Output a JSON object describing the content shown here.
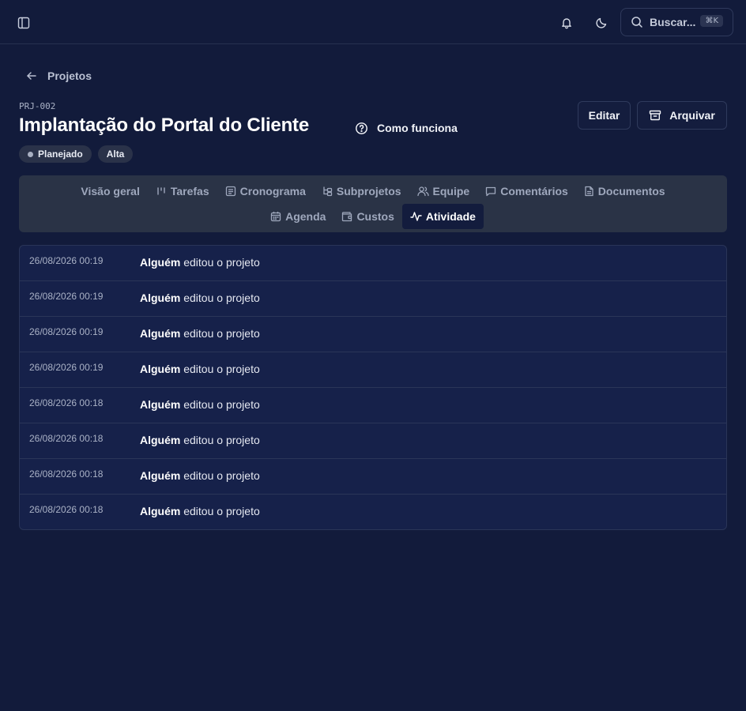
{
  "topbar": {
    "search_placeholder": "Buscar...",
    "search_shortcut": "⌘K",
    "icons": [
      "sidebar-toggle-icon",
      "bell-icon",
      "moon-icon",
      "search-icon"
    ]
  },
  "header": {
    "back_label": "Projetos",
    "project_code": "PRJ-002",
    "title": "Implantação do Portal do Cliente",
    "how_it_works": "Como funciona",
    "status_badge": "Planejado",
    "priority_badge": "Alta",
    "edit_label": "Editar",
    "archive_label": "Arquivar"
  },
  "tabs": {
    "row1": [
      {
        "label": "Visão geral",
        "icon": "none"
      },
      {
        "label": "Tarefas",
        "icon": "kanban-icon"
      },
      {
        "label": "Cronograma",
        "icon": "list-icon"
      },
      {
        "label": "Subprojetos",
        "icon": "tree-icon"
      },
      {
        "label": "Equipe",
        "icon": "users-icon"
      },
      {
        "label": "Comentários",
        "icon": "chat-icon"
      },
      {
        "label": "Documentos",
        "icon": "file-icon"
      }
    ],
    "row2": [
      {
        "label": "Agenda",
        "icon": "calendar-icon"
      },
      {
        "label": "Custos",
        "icon": "wallet-icon"
      },
      {
        "label": "Atividade",
        "icon": "activity-icon",
        "active": true
      }
    ]
  },
  "activity": [
    {
      "time": "26/08/2026 00:19",
      "actor": "Alguém",
      "action": "editou o projeto"
    },
    {
      "time": "26/08/2026 00:19",
      "actor": "Alguém",
      "action": "editou o projeto"
    },
    {
      "time": "26/08/2026 00:19",
      "actor": "Alguém",
      "action": "editou o projeto"
    },
    {
      "time": "26/08/2026 00:19",
      "actor": "Alguém",
      "action": "editou o projeto"
    },
    {
      "time": "26/08/2026 00:18",
      "actor": "Alguém",
      "action": "editou o projeto"
    },
    {
      "time": "26/08/2026 00:18",
      "actor": "Alguém",
      "action": "editou o projeto"
    },
    {
      "time": "26/08/2026 00:18",
      "actor": "Alguém",
      "action": "editou o projeto"
    },
    {
      "time": "26/08/2026 00:18",
      "actor": "Alguém",
      "action": "editou o projeto"
    }
  ],
  "colors": {
    "background": "#121b3b",
    "tabs_background": "#2a3346",
    "active_tab": "#131c3d",
    "list_background": "#16214a"
  }
}
